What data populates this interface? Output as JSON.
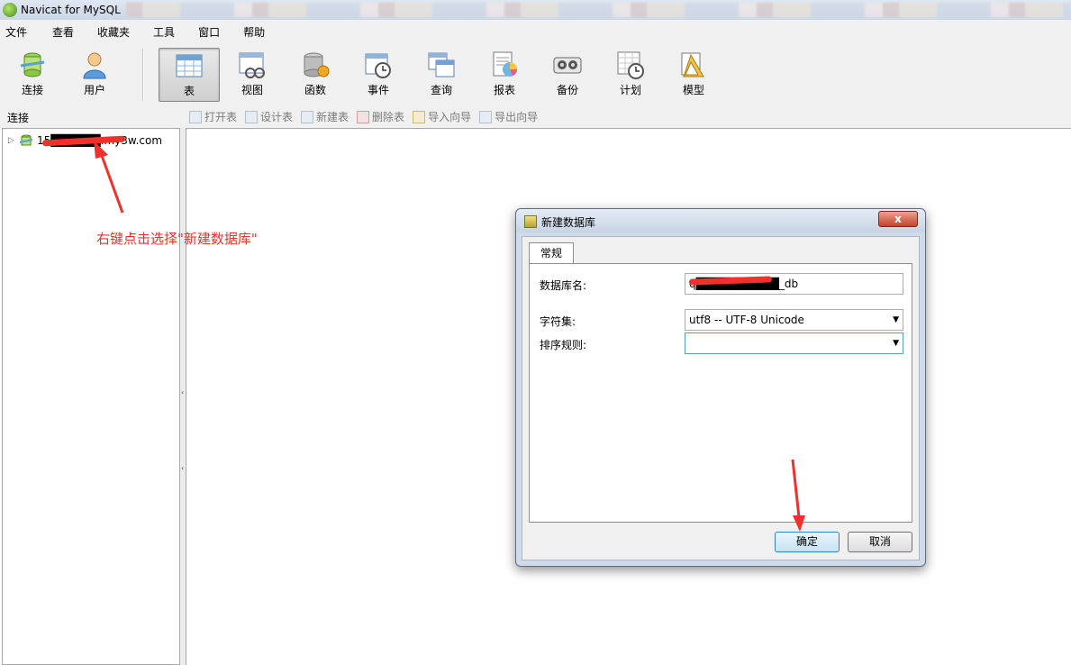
{
  "window": {
    "title": "Navicat for MySQL"
  },
  "menu": {
    "items": [
      "文件",
      "查看",
      "收藏夹",
      "工具",
      "窗口",
      "帮助"
    ]
  },
  "toolbar": {
    "buttons": [
      {
        "label": "连接",
        "icon": "connection-icon"
      },
      {
        "label": "用户",
        "icon": "user-icon"
      },
      {
        "label": "表",
        "icon": "table-icon",
        "active": true
      },
      {
        "label": "视图",
        "icon": "view-icon"
      },
      {
        "label": "函数",
        "icon": "function-icon"
      },
      {
        "label": "事件",
        "icon": "event-icon"
      },
      {
        "label": "查询",
        "icon": "query-icon"
      },
      {
        "label": "报表",
        "icon": "report-icon"
      },
      {
        "label": "备份",
        "icon": "backup-icon"
      },
      {
        "label": "计划",
        "icon": "schedule-icon"
      },
      {
        "label": "模型",
        "icon": "model-icon"
      }
    ]
  },
  "subbar": {
    "connection_label": "连接",
    "actions": [
      "打开表",
      "设计表",
      "新建表",
      "删除表",
      "导入向导",
      "导出向导"
    ]
  },
  "tree": {
    "connection_label": "15██████.my3w.com"
  },
  "annotation": {
    "text": "右键点击选择\"新建数据库\"",
    "color": "#e8332d"
  },
  "dialog": {
    "title": "新建数据库",
    "close_label": "x",
    "tab": "常规",
    "fields": {
      "db_name_label": "数据库名:",
      "db_name_value": "q██████████_db",
      "charset_label": "字符集:",
      "charset_value": "utf8 -- UTF-8 Unicode",
      "collation_label": "排序规则:",
      "collation_value": ""
    },
    "ok_label": "确定",
    "cancel_label": "取消"
  }
}
